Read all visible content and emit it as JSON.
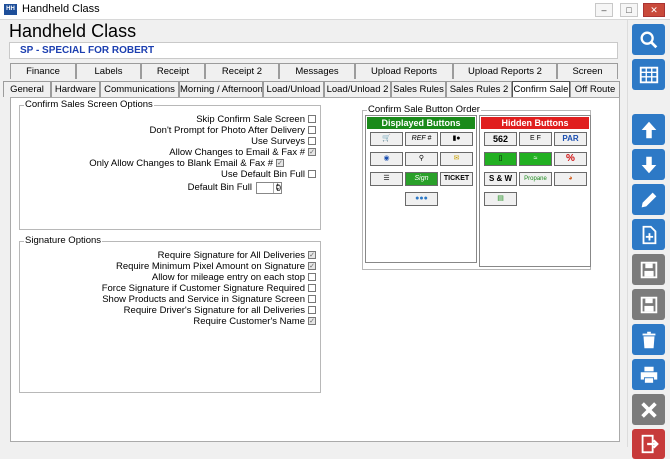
{
  "window": {
    "title": "Handheld Class",
    "app_icon": "HH"
  },
  "form": {
    "title": "Handheld Class",
    "subtitle": "SP - SPECIAL FOR ROBERT"
  },
  "tabs_row1": [
    "Finance",
    "Labels",
    "Receipt",
    "Receipt 2",
    "Messages",
    "Upload Reports",
    "Upload Reports 2",
    "Screen"
  ],
  "tabs_row2": [
    "General",
    "Hardware",
    "Communications",
    "Morning / Afternoon",
    "Load/Unload",
    "Load/Unload 2",
    "Sales Rules",
    "Sales Rules 2",
    "Confirm Sale",
    "Off Route"
  ],
  "active_tab": "Confirm Sale",
  "confirm_group": {
    "label": "Confirm Sales Screen Options",
    "options": [
      {
        "label": "Skip Confirm Sale Screen",
        "checked": false
      },
      {
        "label": "Don't Prompt for Photo After Delivery",
        "checked": false
      },
      {
        "label": "Use Surveys",
        "checked": false
      },
      {
        "label": "Allow Changes to Email & Fax #",
        "checked": true
      },
      {
        "label": "Only Allow Changes to Blank Email & Fax #",
        "checked": true
      },
      {
        "label": "Use Default Bin Full",
        "checked": false
      }
    ],
    "default_bin_label": "Default Bin Full",
    "default_bin_value": "0"
  },
  "signature_group": {
    "label": "Signature Options",
    "options": [
      {
        "label": "Require Signature for All Deliveries",
        "checked": true
      },
      {
        "label": "Require Minimum Pixel Amount on Signature",
        "checked": true
      },
      {
        "label": "Allow for mileage entry on each stop",
        "checked": false
      },
      {
        "label": "Force Signature if Customer Signature Required",
        "checked": false
      },
      {
        "label": "Show Products and Service in Signature Screen",
        "checked": false
      },
      {
        "label": "Require Driver's Signature for all Deliveries",
        "checked": false
      },
      {
        "label": "Require Customer's Name",
        "checked": true
      }
    ]
  },
  "button_order": {
    "label": "Confirm Sale Button Order",
    "displayed_header": "Displayed Buttons",
    "hidden_header": "Hidden Buttons",
    "displayed_color": "#1a8a1a",
    "hidden_color": "#e01e1e",
    "displayed": [
      {
        "icon": "cart-icon",
        "text": ""
      },
      {
        "icon": "ref-number-icon",
        "text": "REF #"
      },
      {
        "icon": "page-count-icon",
        "text": ""
      },
      {
        "icon": "globe-icon",
        "text": ""
      },
      {
        "icon": "magnifier-icon",
        "text": ""
      },
      {
        "icon": "envelope-icon",
        "text": ""
      },
      {
        "icon": "list-icon",
        "text": ""
      },
      {
        "icon": "sign-icon",
        "text": "Sign"
      },
      {
        "icon": "ticket-icon",
        "text": "TICKET"
      },
      {
        "icon": "chat-icon",
        "text": ""
      }
    ],
    "hidden": [
      {
        "icon": "odometer-icon",
        "text": "562"
      },
      {
        "icon": "fuel-gauge-icon",
        "text": "E F"
      },
      {
        "icon": "par-icon",
        "text": "PAR"
      },
      {
        "icon": "id-card-icon",
        "text": ""
      },
      {
        "icon": "wifi-icon",
        "text": ""
      },
      {
        "icon": "percent-icon",
        "text": "%"
      },
      {
        "icon": "sw-icon",
        "text": "S & W"
      },
      {
        "icon": "propane-icon",
        "text": "Propane"
      },
      {
        "icon": "gauge-icon",
        "text": ""
      },
      {
        "icon": "notebook-icon",
        "text": ""
      }
    ]
  },
  "sidebar_buttons": [
    {
      "icon": "search-icon"
    },
    {
      "icon": "grid-icon"
    },
    {
      "icon": "arrow-up-icon"
    },
    {
      "icon": "arrow-down-icon"
    },
    {
      "icon": "pencil-icon"
    },
    {
      "icon": "new-document-icon"
    },
    {
      "icon": "save-new-icon"
    },
    {
      "icon": "save-icon"
    },
    {
      "icon": "trash-icon"
    },
    {
      "icon": "print-icon"
    },
    {
      "icon": "cancel-icon"
    },
    {
      "icon": "exit-icon"
    }
  ]
}
